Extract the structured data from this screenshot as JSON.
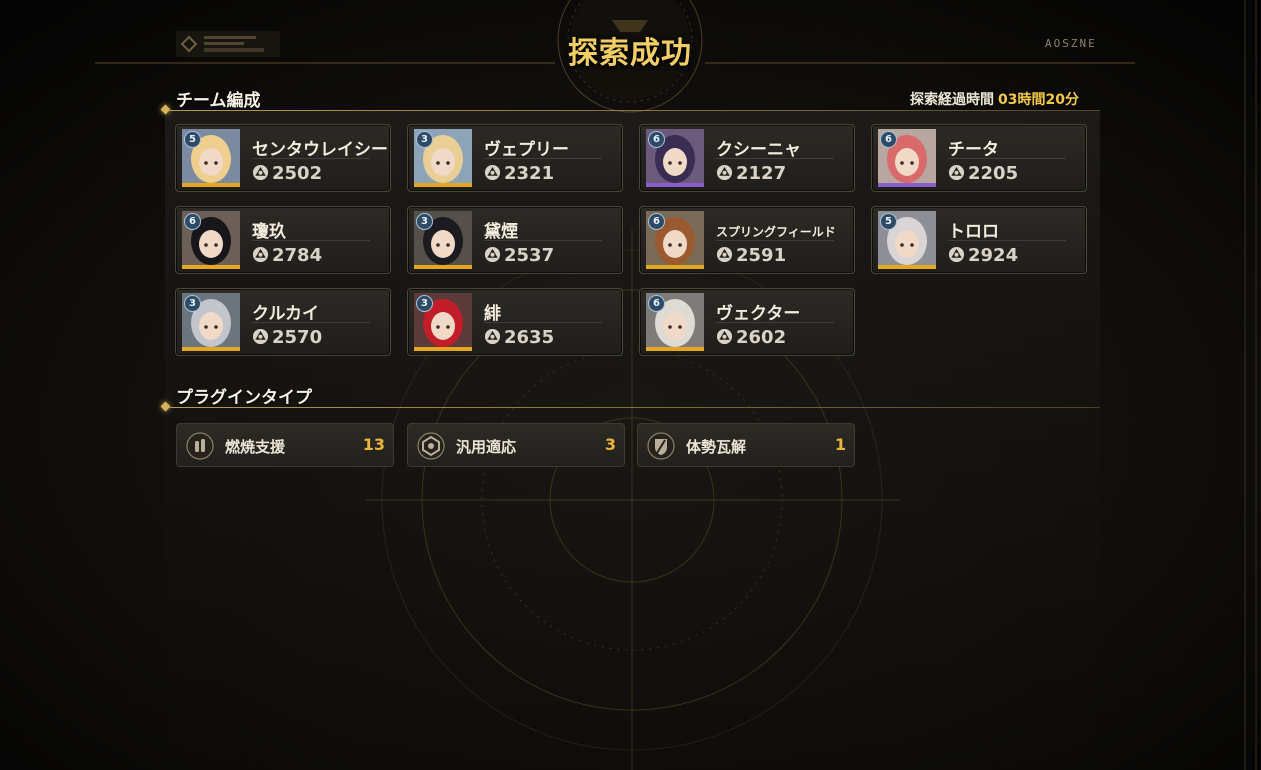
{
  "header": {
    "title": "探索成功",
    "logo_left_label": "gunkan-logo",
    "logo_right_text": "AOSZNE"
  },
  "team": {
    "heading": "チーム編成",
    "elapsed_label": "探索経過時間",
    "elapsed_value": "03時間20分",
    "power_icon": "combat-power-icon",
    "members": [
      {
        "name": "センタウレイシー",
        "rank": "5",
        "power": "2502",
        "rarity_color": "#e3a820",
        "hair": "#f0cf8e",
        "bg": "#7b8aa0"
      },
      {
        "name": "ヴェプリー",
        "rank": "3",
        "power": "2321",
        "rarity_color": "#e3a820",
        "hair": "#e9cf96",
        "bg": "#8da3b8"
      },
      {
        "name": "クシーニャ",
        "rank": "6",
        "power": "2127",
        "rarity_color": "#8b5fc8",
        "hair": "#3a2d52",
        "bg": "#6b5a7c"
      },
      {
        "name": "チータ",
        "rank": "6",
        "power": "2205",
        "rarity_color": "#8b5fc8",
        "hair": "#d96a6a",
        "bg": "#b7a7a0"
      },
      {
        "name": "瓊玖",
        "rank": "6",
        "power": "2784",
        "rarity_color": "#e3a820",
        "hair": "#17161b",
        "bg": "#6c5f58"
      },
      {
        "name": "黛煙",
        "rank": "3",
        "power": "2537",
        "rarity_color": "#e3a820",
        "hair": "#1c1b20",
        "bg": "#55514a"
      },
      {
        "name": "スプリングフィールド",
        "rank": "6",
        "power": "2591",
        "rarity_color": "#e3a820",
        "hair": "#9a5a30",
        "bg": "#7a6a58"
      },
      {
        "name": "トロロ",
        "rank": "5",
        "power": "2924",
        "rarity_color": "#e3a820",
        "hair": "#d9d4d6",
        "bg": "#8e8e96"
      },
      {
        "name": "クルカイ",
        "rank": "3",
        "power": "2570",
        "rarity_color": "#e3a820",
        "hair": "#c2c6cc",
        "bg": "#6c747e"
      },
      {
        "name": "緋",
        "rank": "3",
        "power": "2635",
        "rarity_color": "#e3a820",
        "hair": "#c21e2a",
        "bg": "#5b3a3a"
      },
      {
        "name": "ヴェクター",
        "rank": "6",
        "power": "2602",
        "rarity_color": "#e3a820",
        "hair": "#dedbd5",
        "bg": "#7f7b78"
      }
    ]
  },
  "plugins": {
    "heading": "プラグインタイプ",
    "items": [
      {
        "icon": "burn-support-icon",
        "label": "燃焼支援",
        "count": "13"
      },
      {
        "icon": "general-adapt-icon",
        "label": "汎用適応",
        "count": "3"
      },
      {
        "icon": "posture-break-icon",
        "label": "体勢瓦解",
        "count": "1"
      }
    ]
  },
  "colors": {
    "accent_gold": "#f2c94c",
    "count_gold": "#e9b53c",
    "title_gold": "#f2cf66",
    "frame_gold": "#c8aa5a"
  }
}
